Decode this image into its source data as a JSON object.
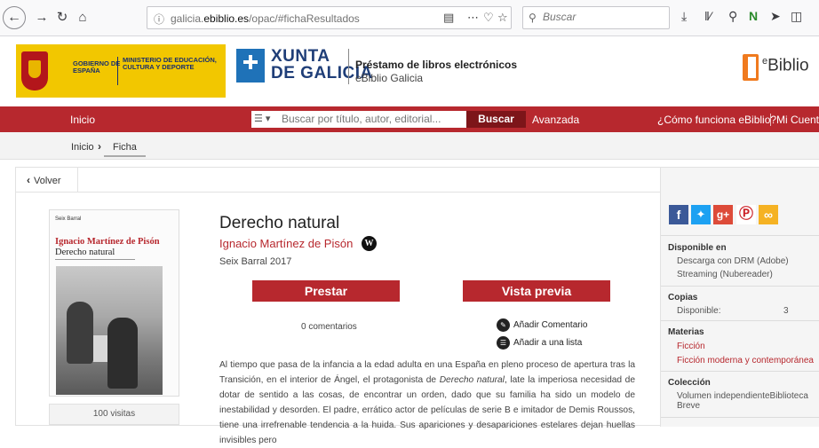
{
  "browser": {
    "url_prefix": "galicia.",
    "url_domain": "ebiblio.es",
    "url_path": "/opac/#fichaResultados",
    "search_placeholder": "Buscar"
  },
  "header": {
    "gobierno": "GOBIERNO DE ESPAÑA",
    "ministerio": "MINISTERIO DE EDUCACIÓN, CULTURA Y DEPORTE",
    "xunta_line1": "XUNTA",
    "xunta_line2": "DE GALICIA",
    "prestamo_title": "Préstamo de libros electrónicos",
    "prestamo_sub": "eBiblio Galicia",
    "logo_e": "e",
    "logo_rest": "Biblio"
  },
  "nav": {
    "inicio": "Inicio",
    "search_placeholder": "Buscar por título, autor, editorial...",
    "buscar": "Buscar",
    "avanzada": "Avanzada",
    "como_funciona": "¿Cómo funciona eBiblio?",
    "mi_cuenta": "Mi Cuenta"
  },
  "breadcrumb": {
    "inicio": "Inicio",
    "ficha": "Ficha"
  },
  "volver": "Volver",
  "cover": {
    "publisher": "Seix Barral",
    "author": "Ignacio Martínez de Pisón",
    "title": "Derecho natural"
  },
  "visitas": "100 visitas",
  "book": {
    "title": "Derecho natural",
    "author": "Ignacio Martínez de Pisón",
    "publisher_year": "Seix Barral 2017",
    "prestar": "Prestar",
    "vista_previa": "Vista previa",
    "comentarios": "0 comentarios",
    "anadir_comentario": "Añadir Comentario",
    "anadir_lista": "Añadir a una lista",
    "synopsis_1": "Al tiempo que pasa de la infancia a la edad adulta en una España en pleno proceso de apertura tras la Transición, en el interior de Ángel, el protagonista de ",
    "synopsis_em": "Derecho natural",
    "synopsis_2": ", late la imperiosa necesidad de dotar de sentido a las cosas, de encontrar un orden, dado que su familia ha sido un modelo de inestabilidad y desorden. El padre, errático actor de películas de serie B e imitador de Demis Roussos, tiene una irrefrenable tendencia a la huida. Sus apariciones y desapariciones estelares dejan huellas invisibles pero"
  },
  "sidebar": {
    "disponible_en": "Disponible en",
    "drm": "Descarga con DRM (Adobe)",
    "streaming": "Streaming (Nubereader)",
    "copias": "Copias",
    "disponible": "Disponible:",
    "disponible_n": "3",
    "materias": "Materias",
    "ficcion": "Ficción",
    "ficcion_moderna": "Ficción moderna y contemporánea",
    "coleccion": "Colección",
    "coleccion_val": "Volumen independienteBiblioteca Breve"
  },
  "colors": {
    "brand_red": "#b7282e",
    "dark_red": "#7d1519",
    "xunta_blue": "#1f72b8",
    "ebiblio_orange": "#f07a1e"
  }
}
